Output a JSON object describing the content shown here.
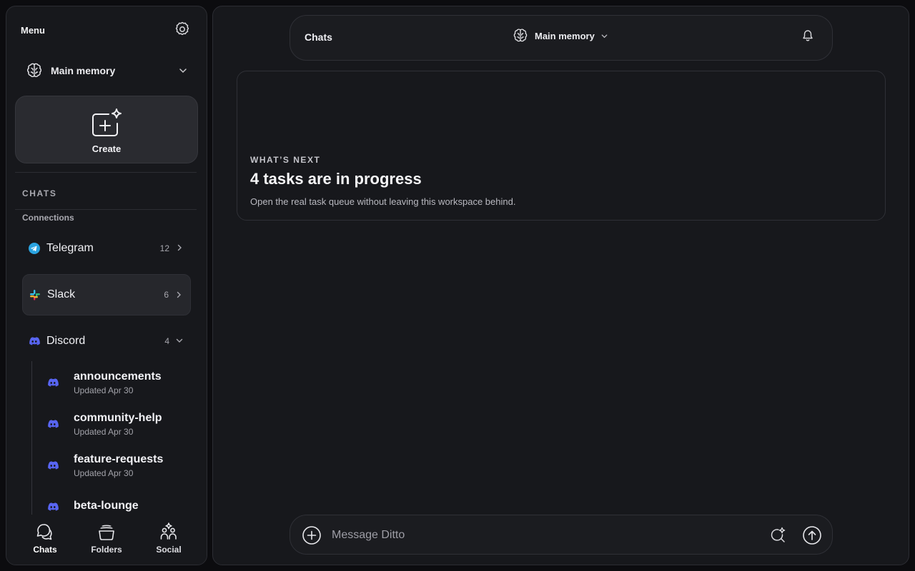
{
  "sidebar": {
    "menu_title": "Menu",
    "memory": {
      "label": "Main memory",
      "icon": "brain-icon"
    },
    "create_label": "Create",
    "section_chats": "CHATS",
    "section_connections": "Connections",
    "connections": [
      {
        "name": "Telegram",
        "count": "12",
        "icon": "telegram-icon",
        "color": "#2aa3e0",
        "expanded": false,
        "active": false
      },
      {
        "name": "Slack",
        "count": "6",
        "icon": "slack-icon",
        "color": "#e01e5a",
        "expanded": false,
        "active": true
      },
      {
        "name": "Discord",
        "count": "4",
        "icon": "discord-icon",
        "color": "#5865f2",
        "expanded": true,
        "active": false
      }
    ],
    "channels": [
      {
        "name": "announcements",
        "updated": "Updated Apr 30"
      },
      {
        "name": "community-help",
        "updated": "Updated Apr 30"
      },
      {
        "name": "feature-requests",
        "updated": "Updated Apr 30"
      },
      {
        "name": "beta-lounge",
        "updated": ""
      }
    ],
    "bottom_nav": [
      {
        "label": "Chats",
        "icon": "chat-bubbles-icon",
        "active": true
      },
      {
        "label": "Folders",
        "icon": "folders-icon",
        "active": false
      },
      {
        "label": "Social",
        "icon": "social-icon",
        "active": false
      }
    ]
  },
  "main": {
    "topbar": {
      "title": "Chats",
      "memory_label": "Main memory"
    },
    "progress_card": {
      "eyebrow": "WHAT’S NEXT",
      "headline": "4 tasks are in progress",
      "subtitle": "Open the real task queue without leaving this workspace behind."
    },
    "composer": {
      "placeholder": "Message Ditto",
      "value": ""
    }
  },
  "colors": {
    "background": "#0c0c0f",
    "panel": "#17181c",
    "border": "#2c2d33",
    "discord": "#5865f2",
    "telegram": "#2aa3e0"
  }
}
